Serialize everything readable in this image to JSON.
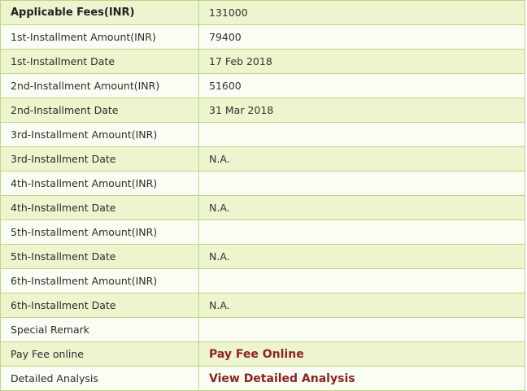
{
  "fee_table": {
    "rows": [
      {
        "label": "Applicable Fees(INR)",
        "value": "131000"
      },
      {
        "label": "1st-Installment Amount(INR)",
        "value": "79400"
      },
      {
        "label": "1st-Installment Date",
        "value": "17 Feb 2018"
      },
      {
        "label": "2nd-Installment Amount(INR)",
        "value": "51600"
      },
      {
        "label": "2nd-Installment Date",
        "value": "31 Mar 2018"
      },
      {
        "label": "3rd-Installment Amount(INR)",
        "value": ""
      },
      {
        "label": "3rd-Installment Date",
        "value": "N.A."
      },
      {
        "label": "4th-Installment Amount(INR)",
        "value": ""
      },
      {
        "label": "4th-Installment Date",
        "value": "N.A."
      },
      {
        "label": "5th-Installment Amount(INR)",
        "value": ""
      },
      {
        "label": "5th-Installment Date",
        "value": "N.A."
      },
      {
        "label": "6th-Installment Amount(INR)",
        "value": ""
      },
      {
        "label": "6th-Installment Date",
        "value": "N.A."
      },
      {
        "label": "Special Remark",
        "value": ""
      },
      {
        "label": "Pay Fee online",
        "link_text": "Pay Fee Online"
      },
      {
        "label": "Detailed Analysis",
        "link_text": "View Detailed Analysis"
      }
    ]
  },
  "colors": {
    "row_odd_bg": "#eef4ce",
    "row_even_bg": "#fafdf3",
    "border": "#b9d787",
    "link": "#8b2323"
  }
}
